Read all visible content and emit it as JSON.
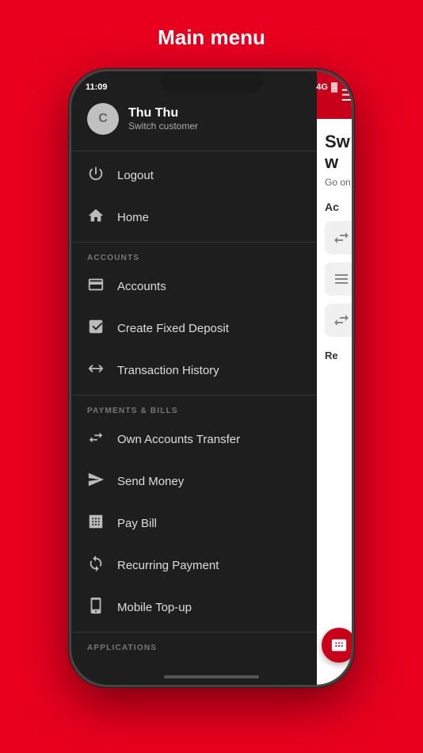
{
  "page": {
    "title": "Main menu",
    "background_color": "#e8001e"
  },
  "status_bar": {
    "time": "11:09",
    "signal": "4G",
    "battery": "🔋"
  },
  "user": {
    "initial": "C",
    "name": "Thu Thu",
    "action": "Switch customer"
  },
  "menu_items_top": [
    {
      "id": "logout",
      "label": "Logout",
      "icon": "power"
    },
    {
      "id": "home",
      "label": "Home",
      "icon": "home"
    }
  ],
  "sections": [
    {
      "id": "accounts",
      "label": "ACCOUNTS",
      "items": [
        {
          "id": "accounts",
          "label": "Accounts",
          "icon": "card"
        },
        {
          "id": "create-fixed-deposit",
          "label": "Create Fixed Deposit",
          "icon": "fixed-deposit"
        },
        {
          "id": "transaction-history",
          "label": "Transaction History",
          "icon": "transaction"
        }
      ]
    },
    {
      "id": "payments",
      "label": "PAYMENTS & BILLS",
      "items": [
        {
          "id": "own-accounts-transfer",
          "label": "Own Accounts Transfer",
          "icon": "transfer"
        },
        {
          "id": "send-money",
          "label": "Send Money",
          "icon": "send"
        },
        {
          "id": "pay-bill",
          "label": "Pay Bill",
          "icon": "bill"
        },
        {
          "id": "recurring-payment",
          "label": "Recurring Payment",
          "icon": "recurring"
        },
        {
          "id": "mobile-topup",
          "label": "Mobile Top-up",
          "icon": "mobile"
        }
      ]
    },
    {
      "id": "applications",
      "label": "APPLICATIONS",
      "items": []
    }
  ],
  "right_panel": {
    "header_text_1": "Sw",
    "header_text_2": "w",
    "sub_text": "Go on",
    "accounts_label": "Ac",
    "re_label": "Re"
  },
  "fab": {
    "icon": "id-card"
  }
}
